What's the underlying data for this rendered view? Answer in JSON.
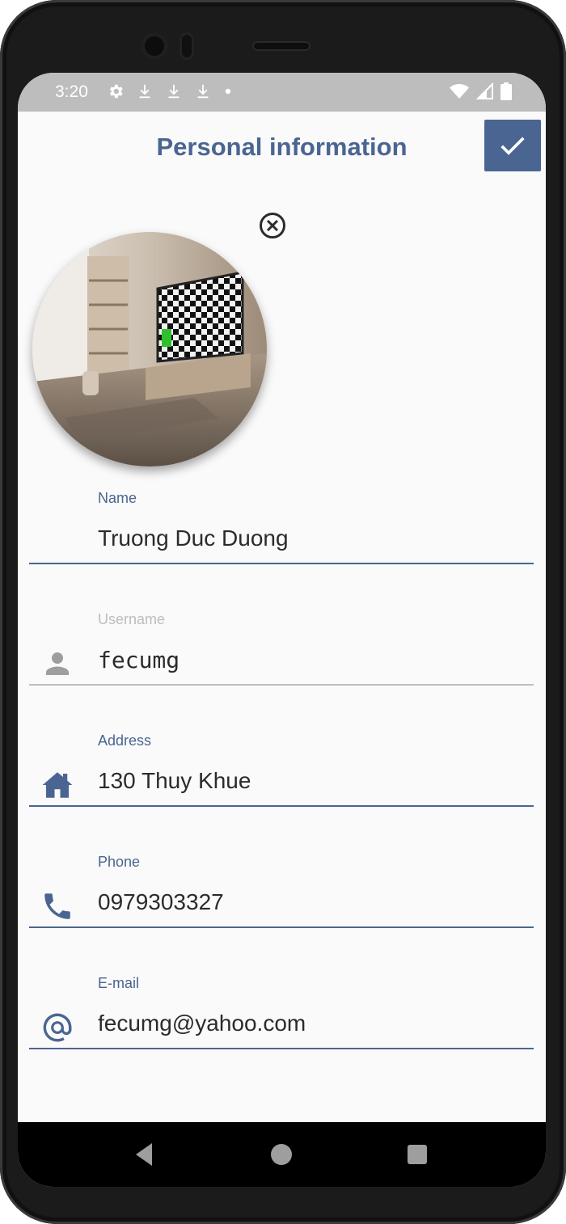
{
  "status_bar": {
    "time": "3:20",
    "left_icons": [
      "gear-icon",
      "download-icon",
      "download-icon",
      "download-icon",
      "dot-icon"
    ],
    "right_icons": [
      "wifi-icon",
      "cell-signal-icon",
      "battery-icon"
    ]
  },
  "header": {
    "title": "Personal information",
    "save_icon": "check-icon"
  },
  "profile": {
    "remove_icon": "close-circle-icon"
  },
  "fields": {
    "name": {
      "label": "Name",
      "value": "Truong Duc Duong"
    },
    "username": {
      "label": "Username",
      "value": "fecumg",
      "icon": "person-icon"
    },
    "address": {
      "label": "Address",
      "value": "130 Thuy Khue",
      "icon": "home-icon"
    },
    "phone": {
      "label": "Phone",
      "value": "0979303327",
      "icon": "phone-icon"
    },
    "email": {
      "label": "E-mail",
      "value": "fecumg@yahoo.com",
      "icon": "at-icon"
    }
  },
  "colors": {
    "primary": "#4a6591",
    "disabled": "#bdbdbd",
    "background": "#fafafa"
  }
}
